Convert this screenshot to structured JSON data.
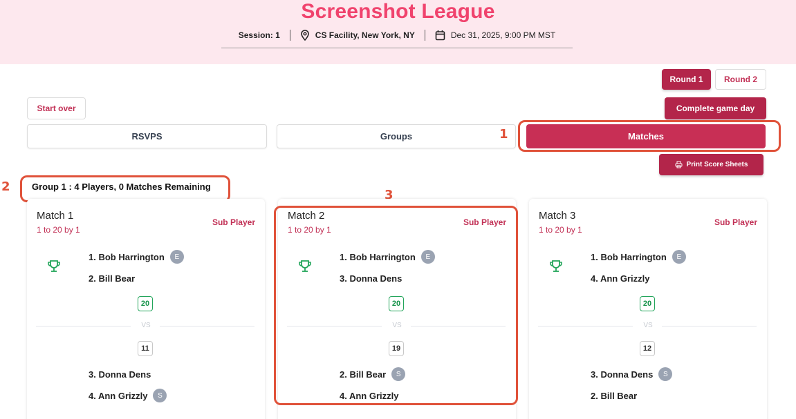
{
  "header": {
    "title": "Screenshot League",
    "session": "Session: 1",
    "location": "CS Facility, New York, NY",
    "datetime": "Dec 31, 2025, 9:00 PM MST"
  },
  "rounds": [
    "Round 1",
    "Round 2"
  ],
  "actions": {
    "start_over": "Start over",
    "complete": "Complete game day",
    "print": "Print Score Sheets"
  },
  "tabs": [
    "RSVPS",
    "Groups",
    "Matches"
  ],
  "annotations": [
    "1",
    "2",
    "3"
  ],
  "group": {
    "title": "Group 1 : 4 Players, 0 Matches Remaining"
  },
  "matches": [
    {
      "title": "Match 1",
      "subtitle": "1 to 20 by 1",
      "sub_label": "Sub Player",
      "team1": [
        {
          "name": "1. Bob Harrington",
          "badge": "E"
        },
        {
          "name": "2. Bill Bear",
          "badge": ""
        }
      ],
      "score1": "20",
      "vs": "VS",
      "score2": "11",
      "team2": [
        {
          "name": "3. Donna Dens",
          "badge": ""
        },
        {
          "name": "4. Ann Grizzly",
          "badge": "S"
        }
      ]
    },
    {
      "title": "Match 2",
      "subtitle": "1 to 20 by 1",
      "sub_label": "Sub Player",
      "team1": [
        {
          "name": "1. Bob Harrington",
          "badge": "E"
        },
        {
          "name": "3. Donna Dens",
          "badge": ""
        }
      ],
      "score1": "20",
      "vs": "VS",
      "score2": "19",
      "team2": [
        {
          "name": "2. Bill Bear",
          "badge": "S"
        },
        {
          "name": "4. Ann Grizzly",
          "badge": ""
        }
      ]
    },
    {
      "title": "Match 3",
      "subtitle": "1 to 20 by 1",
      "sub_label": "Sub Player",
      "team1": [
        {
          "name": "1. Bob Harrington",
          "badge": "E"
        },
        {
          "name": "4. Ann Grizzly",
          "badge": ""
        }
      ],
      "score1": "20",
      "vs": "VS",
      "score2": "12",
      "team2": [
        {
          "name": "3. Donna Dens",
          "badge": "S"
        },
        {
          "name": "2. Bill Bear",
          "badge": ""
        }
      ]
    }
  ],
  "colors": {
    "brand": "#f0436d",
    "primary": "#b3254a",
    "active_tab": "#c82f55",
    "win": "#16934a",
    "highlight": "#e0523a",
    "header_bg": "#fde8ee"
  }
}
